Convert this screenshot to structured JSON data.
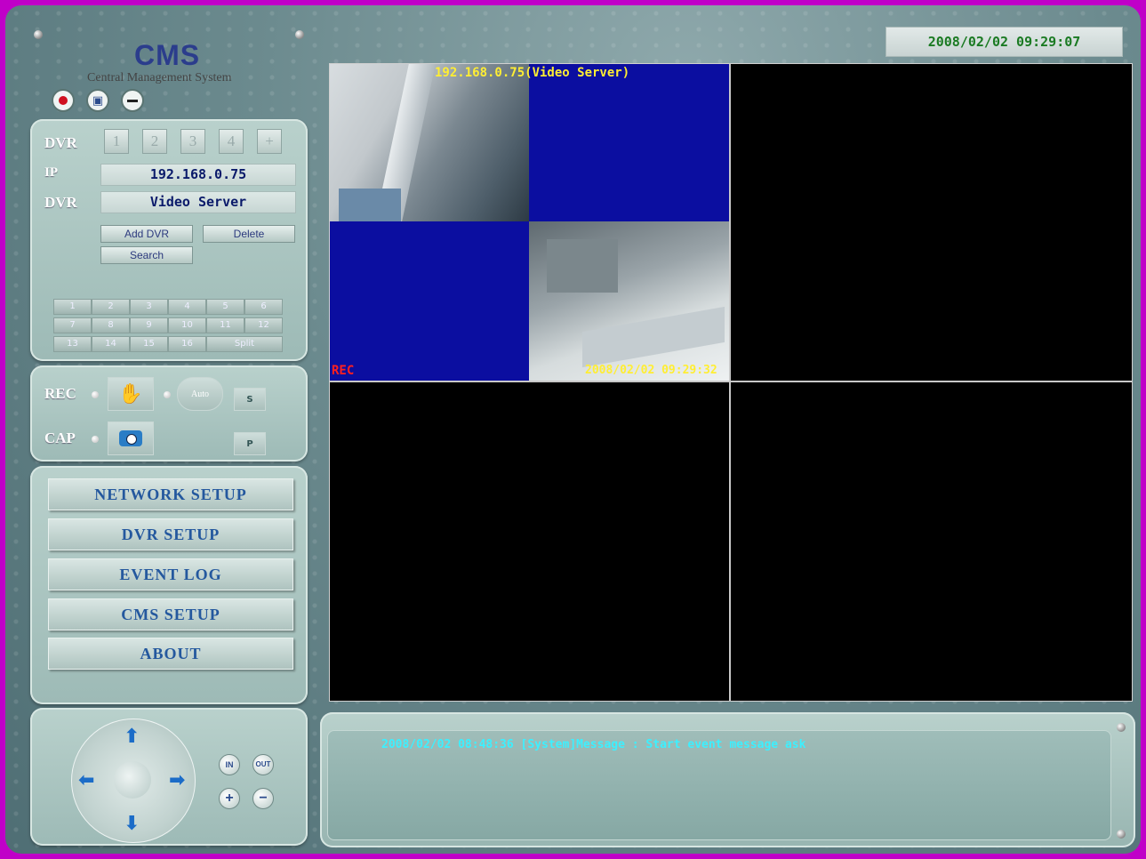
{
  "app": {
    "logo": "CMS",
    "subtitle": "Central Management System",
    "datetime": "2008/02/02 09:29:07"
  },
  "dvr_panel": {
    "dvr_label": "DVR",
    "dvr_buttons": [
      "1",
      "2",
      "3",
      "4",
      "+"
    ],
    "ip_label": "IP",
    "ip_value": "192.168.0.75",
    "dvr_name_label": "DVR",
    "dvr_name_value": "Video Server",
    "add_dvr": "Add DVR",
    "delete": "Delete",
    "search": "Search",
    "channels": [
      "1",
      "2",
      "3",
      "4",
      "5",
      "6",
      "7",
      "8",
      "9",
      "10",
      "11",
      "12",
      "13",
      "14",
      "15",
      "16"
    ],
    "split": "Split"
  },
  "record_panel": {
    "rec_label": "REC",
    "cap_label": "CAP",
    "auto_label": "Auto",
    "s_label": "S",
    "p_label": "P"
  },
  "menu": [
    "NETWORK SETUP",
    "DVR SETUP",
    "EVENT LOG",
    "CMS SETUP",
    "ABOUT"
  ],
  "ptz": {
    "zoom_in": "IN",
    "zoom_out": "OUT",
    "focus_plus": "+",
    "focus_minus": "−"
  },
  "video": {
    "cam_title": "192.168.0.75(Video Server)",
    "rec_indicator": "REC",
    "timestamp": "2008/02/02 09:29:32"
  },
  "message": "2008/02/02 08:48:36 [System]Message : Start event message ask",
  "colors": {
    "accent": "#2b3d8c",
    "clock_text": "#1a7a22",
    "message_text": "#3cf0ff",
    "video_blue": "#0b0ea0",
    "osd_yellow": "#ffee33",
    "rec_red": "#ff2020"
  }
}
